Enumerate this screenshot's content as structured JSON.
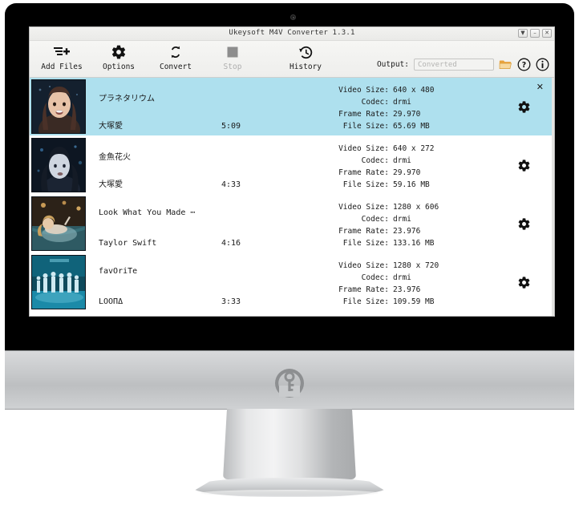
{
  "device": {
    "name": "imac-monitor",
    "logo_icon": "key-circle-logo",
    "webcam_icon": "webcam-dot"
  },
  "window": {
    "title": "Ukeysoft M4V Converter 1.3.1",
    "controls": [
      {
        "name": "minimize-to-tray-button",
        "glyph": "▼"
      },
      {
        "name": "minimize-button",
        "glyph": "–"
      },
      {
        "name": "close-button",
        "glyph": "✕"
      }
    ]
  },
  "toolbar": {
    "add_files_label": "Add Files",
    "options_label": "Options",
    "convert_label": "Convert",
    "stop_label": "Stop",
    "history_label": "History",
    "stop_disabled": true,
    "output_label": "Output:",
    "output_value": "",
    "output_placeholder": "Converted",
    "folder_icon": "folder-icon",
    "help_icon": "help-circle-icon",
    "info_icon": "info-circle-icon"
  },
  "list": {
    "selected_index": 0,
    "close_glyph": "✕",
    "labels": {
      "video_size": "Video Size:",
      "codec": "Codec:",
      "frame_rate": "Frame Rate:",
      "file_size": "File Size:"
    },
    "rows": [
      {
        "title": "プラネタリウム",
        "artist": "大塚愛",
        "duration": "5:09",
        "video_size": "640 x 480",
        "codec": "drmi",
        "frame_rate": "29.970",
        "file_size": "65.69 MB",
        "thumb": "thumb-planetarium"
      },
      {
        "title": "金魚花火",
        "artist": "大塚愛",
        "duration": "4:33",
        "video_size": "640 x 272",
        "codec": "drmi",
        "frame_rate": "29.970",
        "file_size": "59.16 MB",
        "thumb": "thumb-kingyo-hanabi"
      },
      {
        "title": "Look What You Made ⋯",
        "artist": "Taylor Swift",
        "duration": "4:16",
        "video_size": "1280 x 606",
        "codec": "drmi",
        "frame_rate": "23.976",
        "file_size": "133.16 MB",
        "thumb": "thumb-look-what-you-made"
      },
      {
        "title": "favOriTe",
        "artist": "LOOΠΔ",
        "duration": "3:33",
        "video_size": "1280 x 720",
        "codec": "drmi",
        "frame_rate": "23.976",
        "file_size": "109.59 MB",
        "thumb": "thumb-favorite"
      }
    ]
  },
  "colors": {
    "selected_row": "#aee0ee",
    "toolbar_bg": "#f2f2f0",
    "bezel": "#000000",
    "chin": "#c9cbcd"
  }
}
